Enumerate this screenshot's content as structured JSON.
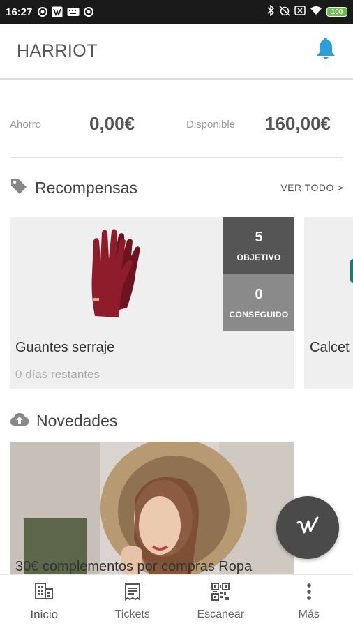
{
  "status_bar": {
    "time": "16:27",
    "battery": "100",
    "icons": [
      "record-icon",
      "w-app-icon",
      "keyboard-icon",
      "record-icon",
      "bluetooth-icon",
      "alarm-off-icon",
      "no-sim-icon",
      "wifi-icon"
    ]
  },
  "app_bar": {
    "title": "HARRIOT",
    "icon": "bell-icon",
    "accent": "#2e9fd6"
  },
  "balance": {
    "ahorro_label": "Ahorro",
    "ahorro_value": "0,00€",
    "disponible_label": "Disponible",
    "disponible_value": "160,00€"
  },
  "rewards": {
    "title": "Recompensas",
    "icon": "tag-icon",
    "view_all": "VER TODO >",
    "items": [
      {
        "name": "Guantes serraje",
        "days": "0 días restantes",
        "objective_value": "5",
        "objective_label": "OBJETIVO",
        "achieved_value": "0",
        "achieved_label": "CONSEGUIDO"
      },
      {
        "name": "Calcet"
      }
    ]
  },
  "news": {
    "title": "Novedades",
    "icon": "cloud-upload-icon",
    "items": [
      {
        "title": "30€ complementos por compras Ropa"
      }
    ]
  },
  "fab": {
    "icon": "w-logo-icon"
  },
  "bottom_nav": {
    "items": [
      {
        "label": "Inicio",
        "icon": "building-icon"
      },
      {
        "label": "Tickets",
        "icon": "receipt-icon"
      },
      {
        "label": "Escanear",
        "icon": "qr-code-icon"
      },
      {
        "label": "Más",
        "icon": "more-vertical-icon"
      }
    ]
  }
}
